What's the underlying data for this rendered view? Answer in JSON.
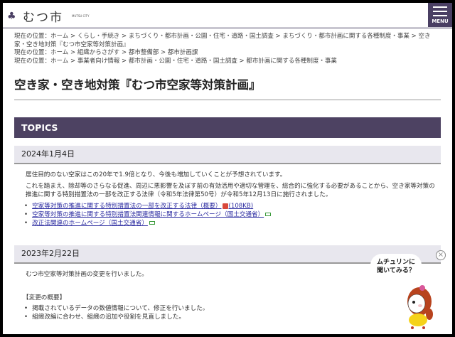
{
  "header": {
    "logo_text": "むつ市",
    "logo_sub": "MUTSU CITY",
    "menu_label": "MENU"
  },
  "breadcrumbs": [
    {
      "prefix": "現在の位置：",
      "items": [
        "ホーム",
        "くらし・手続き",
        "まちづくり・都市計画・公園・住宅・道路・国土調査",
        "まちづくり・都市計画に関する各種制度・事業",
        "空き家・空き地対策『むつ市空家等対策計画』"
      ]
    },
    {
      "prefix": "現在の位置：",
      "items": [
        "ホーム",
        "組織からさがす",
        "都市整備部",
        "都市計画課"
      ]
    },
    {
      "prefix": "現在の位置：",
      "items": [
        "ホーム",
        "事業者向け情報",
        "都市計画・公園・住宅・道路・国土調査",
        "都市計画に関する各種制度・事業"
      ]
    }
  ],
  "page_title": "空き家・空き地対策『むつ市空家等対策計画』",
  "topics_label": "TOPICS",
  "topics": [
    {
      "date": "2024年1月4日",
      "paragraphs": [
        "居住目的のない空家はこの20年で1.9倍となり、今後も増加していくことが予想されています。",
        "これを踏まえ、除却等のさらなる促進、周辺に悪影響を及ぼす前の有効活用や適切な管理を、総合的に強化する必要があることから、空き家等対策の推進に関する特別措置法の一部を改正する法律（令和5年法律第50号）が令和5年12月13日に施行されました。"
      ],
      "links": [
        {
          "text": "空家等対策の推進に関する特別措置法の一部を改正する法律（概要）",
          "size": "(108KB)",
          "icon": "pdf-icon"
        },
        {
          "text": "空家等対策の推進に関する特別措置法関連情報に関するホームページ（国土交通省）",
          "icon": "external-link-icon"
        },
        {
          "text": "改正法関連のホームページ（国土交通省）",
          "icon": "external-link-icon"
        }
      ]
    },
    {
      "date": "2023年2月22日",
      "paragraphs": [
        "むつ市空家等対策計画の変更を行いました。"
      ],
      "summary_label": "【変更の概要】",
      "bullets": [
        "掲載されているデータの数値情報について、修正を行いました。",
        "組織改編に合わせ、組織の追加や役割を見直しました。"
      ]
    }
  ],
  "chatbot": {
    "line1": "ムチュリンに",
    "line2": "聞いてみる？",
    "close": "×"
  }
}
